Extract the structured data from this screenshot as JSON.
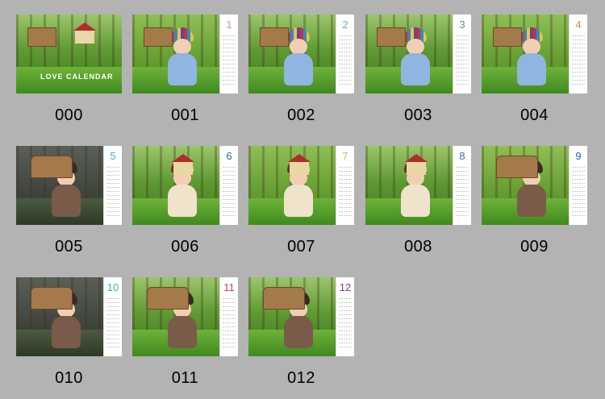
{
  "thumbnails": [
    {
      "label": "000",
      "caption": "LOVE CALENDAR",
      "month": "",
      "month_color": "#ffffff",
      "style": "forest",
      "kid": "none"
    },
    {
      "label": "001",
      "caption": "",
      "month": "1",
      "month_color": "#d98aa9",
      "style": "warm",
      "kid": "stripe"
    },
    {
      "label": "002",
      "caption": "",
      "month": "2",
      "month_color": "#5bb7c9",
      "style": "forest",
      "kid": "stripe"
    },
    {
      "label": "003",
      "caption": "",
      "month": "3",
      "month_color": "#4fa35e",
      "style": "forest",
      "kid": "stripe"
    },
    {
      "label": "004",
      "caption": "",
      "month": "4",
      "month_color": "#e08d4b",
      "style": "warm",
      "kid": "stripe"
    },
    {
      "label": "005",
      "caption": "",
      "month": "5",
      "month_color": "#4aa8d8",
      "style": "dark",
      "kid": "brown"
    },
    {
      "label": "006",
      "caption": "",
      "month": "6",
      "month_color": "#3c5fa8",
      "style": "forest",
      "kid": "cream"
    },
    {
      "label": "007",
      "caption": "",
      "month": "7",
      "month_color": "#e3b23c",
      "style": "warm",
      "kid": "cream"
    },
    {
      "label": "008",
      "caption": "",
      "month": "8",
      "month_color": "#3d6fb0",
      "style": "forest",
      "kid": "cream"
    },
    {
      "label": "009",
      "caption": "",
      "month": "9",
      "month_color": "#2e5da8",
      "style": "warm",
      "kid": "brown"
    },
    {
      "label": "010",
      "caption": "",
      "month": "10",
      "month_color": "#36b3a6",
      "style": "dark",
      "kid": "brown"
    },
    {
      "label": "011",
      "caption": "",
      "month": "11",
      "month_color": "#d13a4c",
      "style": "forest",
      "kid": "brown"
    },
    {
      "label": "012",
      "caption": "",
      "month": "12",
      "month_color": "#7a3b86",
      "style": "forest",
      "kid": "brown"
    }
  ]
}
